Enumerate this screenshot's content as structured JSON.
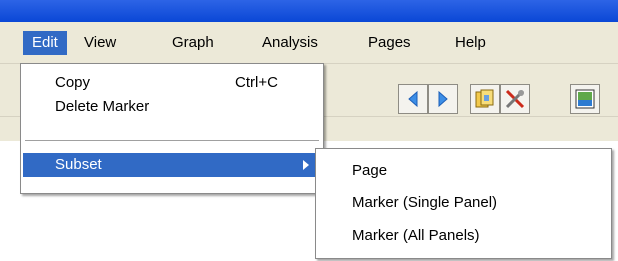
{
  "menubar": {
    "items": [
      {
        "label": "Edit"
      },
      {
        "label": "View"
      },
      {
        "label": "Graph"
      },
      {
        "label": "Analysis"
      },
      {
        "label": "Pages"
      },
      {
        "label": "Help"
      }
    ]
  },
  "edit_menu": {
    "items": [
      {
        "label": "Copy",
        "shortcut": "Ctrl+C"
      },
      {
        "label": "Delete Marker"
      },
      {
        "label": "Subset"
      }
    ]
  },
  "subset_menu": {
    "items": [
      {
        "label": "Page"
      },
      {
        "label": "Marker (Single Panel)"
      },
      {
        "label": "Marker (All Panels)"
      }
    ]
  },
  "icons": [
    "prev-arrow-icon",
    "next-arrow-icon",
    "page-copy-icon",
    "settings-tools-icon",
    "picture-icon"
  ],
  "colors": {
    "highlight": "#316ac5",
    "menubar": "#ece9d8",
    "titlebar": "#0a47d6"
  }
}
